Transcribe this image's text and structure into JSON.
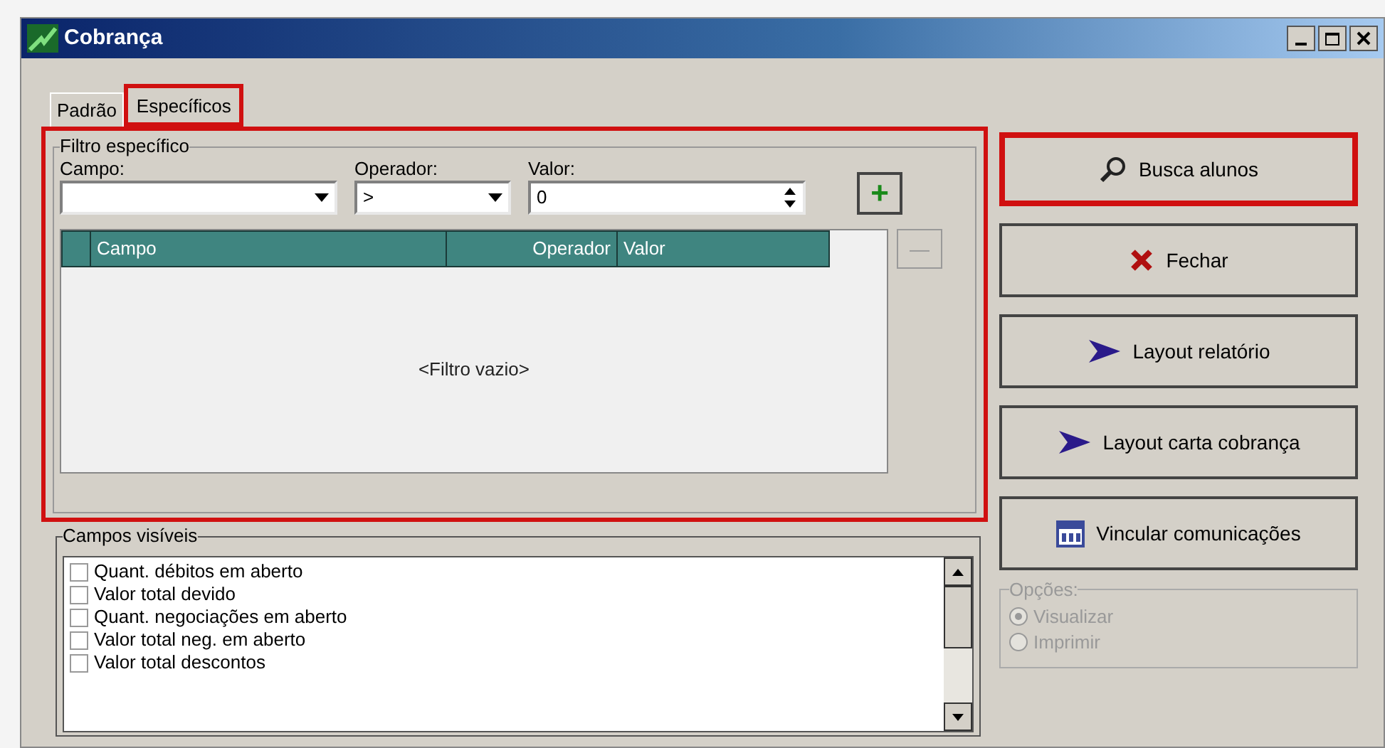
{
  "window": {
    "title": "Cobrança"
  },
  "tabs": [
    {
      "label": "Padrão",
      "selected": false,
      "highlighted": false
    },
    {
      "label": "Específicos",
      "selected": true,
      "highlighted": true
    }
  ],
  "filter": {
    "title": "Filtro específico",
    "highlighted": true,
    "campo": {
      "label": "Campo:"
    },
    "operador": {
      "label": "Operador:",
      "value": ">"
    },
    "valor": {
      "label": "Valor:",
      "value": "0"
    },
    "add_button": {
      "label": "+",
      "disabled": false
    },
    "remove_button": {
      "label": "—",
      "disabled": true
    },
    "table": {
      "columns": [
        "Campo",
        "Operador",
        "Valor"
      ],
      "empty_text": "<Filtro vazio>"
    }
  },
  "visible_fields": {
    "title": "Campos visíveis",
    "items": [
      {
        "label": "Quant. débitos em aberto",
        "checked": false
      },
      {
        "label": "Valor total devido",
        "checked": false
      },
      {
        "label": "Quant. negociações em aberto",
        "checked": false
      },
      {
        "label": "Valor total neg. em aberto",
        "checked": false
      },
      {
        "label": "Valor total descontos",
        "checked": false
      }
    ]
  },
  "actions": [
    {
      "label": "Busca alunos",
      "kind": "search",
      "highlighted": true
    },
    {
      "label": "Fechar",
      "kind": "close",
      "highlighted": false
    },
    {
      "label": "Layout relatório",
      "kind": "layout",
      "highlighted": false
    },
    {
      "label": "Layout carta cobrança",
      "kind": "layout",
      "highlighted": false
    },
    {
      "label": "Vincular comunicações",
      "kind": "link",
      "highlighted": false
    }
  ],
  "options": {
    "title": "Opções:",
    "disabled": true,
    "items": [
      {
        "label": "Visualizar",
        "selected": true
      },
      {
        "label": "Imprimir",
        "selected": false
      }
    ]
  }
}
